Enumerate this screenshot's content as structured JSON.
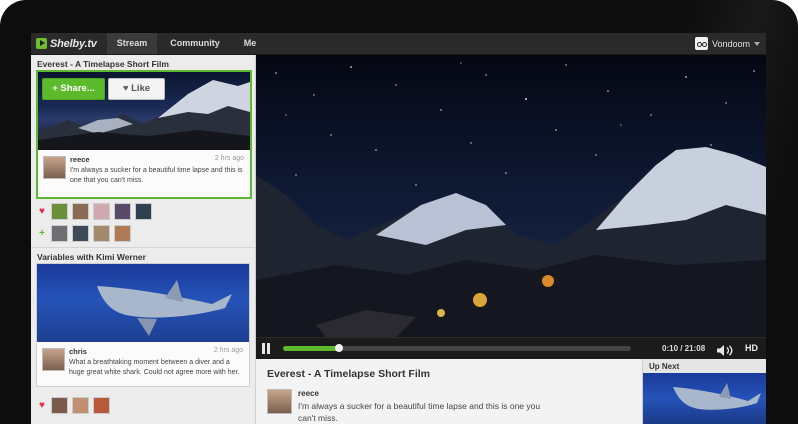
{
  "app": {
    "logo_text": "Shelby.tv"
  },
  "nav": {
    "tabs": [
      {
        "label": "Stream"
      },
      {
        "label": "Community"
      },
      {
        "label": "Me"
      }
    ],
    "active_tab": "Stream"
  },
  "user": {
    "name": "Vondoom"
  },
  "feed": {
    "items": [
      {
        "title": "Everest - A Timelapse Short Film",
        "share_label": "+ Share...",
        "like_label": "Like",
        "comment": {
          "author": "reece",
          "time": "2 hrs ago",
          "text": "I'm always a sucker for a beautiful time lapse and this is one that you can't miss."
        },
        "likes_icon": "heart-icon",
        "shares_icon": "plus-icon"
      },
      {
        "title": "Variables with Kimi Werner",
        "comment": {
          "author": "chris",
          "time": "2 hrs ago",
          "text": "What a breathtaking moment between a diver and a huge great white shark. Could not agree more with her."
        },
        "likes_icon": "heart-icon"
      }
    ]
  },
  "player": {
    "time_display": "0:10 / 21:08",
    "progress": 0.16,
    "hd_label": "HD"
  },
  "now_playing": {
    "title": "Everest - A Timelapse Short Film",
    "author": "reece",
    "text": "I'm always a sucker for a beautiful time lapse and this is one you can't miss."
  },
  "up_next": {
    "label": "Up Next"
  },
  "colors": {
    "accent": "#5cba2c",
    "topbar": "#2a2a2a",
    "heart": "#e0304a"
  }
}
